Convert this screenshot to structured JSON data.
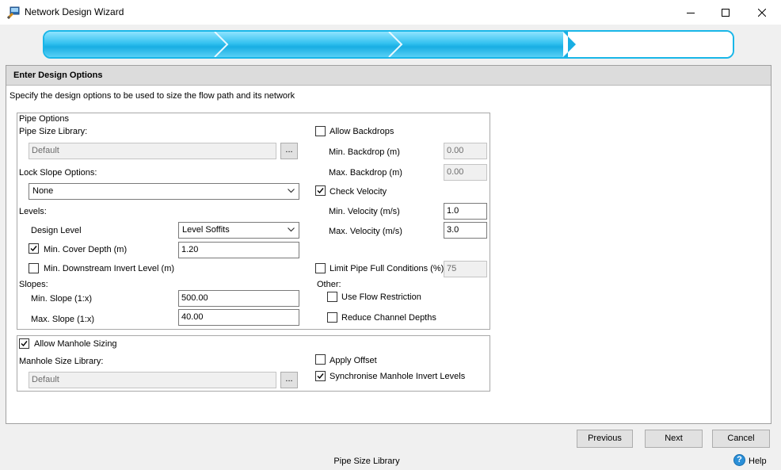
{
  "window": {
    "title": "Network Design Wizard",
    "controls": {
      "minimize": "minimize-icon",
      "maximize": "maximize-icon",
      "close": "close-icon"
    }
  },
  "progress": {
    "steps_total": 4,
    "steps_done": 3,
    "color": "#19b6e8"
  },
  "panel": {
    "header": "Enter Design Options",
    "description": "Specify the design options to be used to size the flow path and its network"
  },
  "pipe_options": {
    "legend": "Pipe Options",
    "size_library_label": "Pipe Size Library:",
    "size_library_value": "Default",
    "browse_label": "...",
    "lock_slope_label": "Lock Slope Options:",
    "lock_slope_value": "None",
    "levels_label": "Levels:",
    "design_level_label": "Design Level",
    "design_level_value": "Level Soffits",
    "min_cover_depth_label": "Min. Cover Depth (m)",
    "min_cover_depth_checked": true,
    "min_cover_depth_value": "1.20",
    "min_downstream_invert_label": "Min. Downstream Invert Level (m)",
    "min_downstream_invert_checked": false,
    "slopes_label": "Slopes:",
    "min_slope_label": "Min. Slope (1:x)",
    "min_slope_value": "500.00",
    "max_slope_label": "Max. Slope (1:x)",
    "max_slope_value": "40.00",
    "allow_backdrops_label": "Allow Backdrops",
    "allow_backdrops_checked": false,
    "min_backdrop_label": "Min. Backdrop (m)",
    "min_backdrop_value": "0.00",
    "max_backdrop_label": "Max. Backdrop (m)",
    "max_backdrop_value": "0.00",
    "check_velocity_label": "Check Velocity",
    "check_velocity_checked": true,
    "min_velocity_label": "Min. Velocity (m/s)",
    "min_velocity_value": "1.0",
    "max_velocity_label": "Max. Velocity (m/s)",
    "max_velocity_value": "3.0",
    "limit_pipe_full_label": "Limit Pipe Full Conditions (%)",
    "limit_pipe_full_checked": false,
    "limit_pipe_full_value": "75",
    "other_label": "Other:",
    "use_flow_restriction_label": "Use Flow Restriction",
    "use_flow_restriction_checked": false,
    "reduce_channel_depths_label": "Reduce Channel Depths",
    "reduce_channel_depths_checked": false
  },
  "manhole": {
    "allow_sizing_label": "Allow Manhole Sizing",
    "allow_sizing_checked": true,
    "size_library_label": "Manhole Size Library:",
    "size_library_value": "Default",
    "browse_label": "...",
    "apply_offset_label": "Apply Offset",
    "apply_offset_checked": false,
    "synchronise_label": "Synchronise Manhole Invert Levels",
    "synchronise_checked": true
  },
  "footer": {
    "previous_label": "Previous",
    "next_label": "Next",
    "cancel_label": "Cancel",
    "status_text": "Pipe Size Library",
    "help_label": "Help",
    "help_icon_glyph": "?"
  }
}
